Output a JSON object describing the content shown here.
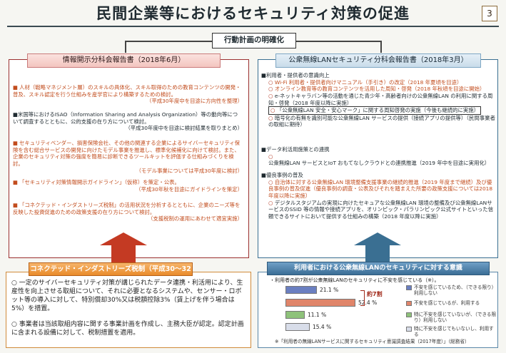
{
  "title": "民間企業等におけるセキュリティ対策の促進",
  "page_number": "3",
  "action_plan_label": "行動計画の明確化",
  "left_panel": {
    "heading": "情報開示分科会報告書（2018年6月）",
    "item1_text": "人材（戦略マネジメント層）のスキルの具体化、スキル取得のための教育コンテンツの開発・普及、スキル認定を行う仕組みを産学官により構築するための検討。",
    "item1_tag": "（平成30年度中を目途に方向性を整理）",
    "item2_text": "米国等におけるISAO（Information Sharing and Analysis Organization）等の動向等について調査するとともに、公的支援の在り方について検討。",
    "item2_tag": "（平成30年度中を目途に検討結果を取りまとめ）",
    "item3_text": "セキュリティベンダー、損害保険会社、その他の関連する企業によるサイバーセキュリティ保険を含む総合サービスの開発に向けたモデル事業を推進し、標準化候補化に向けて検討。また、企業のセキュリティ対策の強度を簡易に診断できるツールキットを評価する仕組みづくりを検討。",
    "item3_tag": "（モデル事業については平成30年度に検討）",
    "item4_text": "「セキュリティ対策情報開示ガイドライン」（仮称）を策定・公表。",
    "item4_tag": "（平成30年秋を目途にガイドラインを策定）",
    "item5_text": "「コネクテッド・インダストリーズ税制」の活用状況を分析するとともに、企業のニーズ等を反映した投資促進のための政策支援の在り方について検討。",
    "item5_tag": "（支援税制の運用にあわせて適宜実施）"
  },
  "right_panel": {
    "heading": "公衆無線LANセキュリティ分科会報告書（2018年3月）",
    "sec1_title": "利用者・提供者の意識向上",
    "sec1_a": "Wi-Fi 利用者・提供者向けマニュアル（手引き）の改定（2018 年夏頃を目途）",
    "sec1_b": "オンライン教育等の教育コンテンツを活用した周知・啓発（2018 年秋頃を目途に開始）",
    "sec1_c": "e-ネットキャラバン等の活動を通じた青少年・高齢者向けの公衆無線LAN の利用に関する周知・啓発（2018 年度以降に実施）",
    "sec1_d": "「公衆無線LAN 安全・安心マーク」に関する周知啓発の実施（今後も継続的に実施）",
    "sec1_e": "暗号化の有無を識別可能な公衆無線LAN サービスの提供（接続アプリの提供等）（民間事業者の取組に期待）",
    "sec2_title": "データ利活用施策との連携",
    "sec2_a": "公衆無線LAN サービスとIoT おもてなしクラウドとの連携推進（2019 年中を目途に実用化）",
    "sec3_title": "優良事例の普及",
    "sec3_a": "自治体に対する公衆無線LAN 環境整備支援事業の継続的推進（2019 年度まで継続）及び優良事例の普及促進（優良事例の調査・公表及びそれを踏まえた所要の政策支援については2018年度以降に実施）",
    "sec3_b": "デジタルスタジアムの実現に向けたセキュアな公衆無線LAN 環境の整備及び公衆無線LANサービスのSSID 等の情報や接続アプリを、オリンピック・パラリンピック公式サイトといった信頼できるサイトにおいて提供する仕組みの構築（2018 年度以降に実施）"
  },
  "tax_panel": {
    "heading": "コネクテッド・インダストリーズ税制（平成30～32年度）",
    "para1": "一定のサイバーセキュリティ対策が講じられたデータ連携・利活用により、生産性を向上させる取組について、それに必要となるシステムや、センサー・ロボット等の導入に対して、特別償却30%又は税額控除3%（賃上げを伴う場合は5%）を措置。",
    "para2": "事業者は当該取組内容に関する事業計画を作成し、主務大臣が認定。認定計画に含まれる設備に対して、税制措置を適用。"
  },
  "survey_panel": {
    "heading": "利用者における公衆無線LANのセキュリティに対する意識",
    "note": "・利用者の約7割が公衆無線LANのセキュリティに不安を感じている（※）。",
    "brace_label": "約7割",
    "source": "※「利用者の無線LANサービスに関するセキュリティ意識調査結果（2017年度）」（総務省）"
  },
  "chart_data": {
    "type": "bar",
    "orientation": "horizontal",
    "categories": [
      "不安を感じているため、（できる限り）利用しない",
      "不安を感じているが、利用する",
      "特に不安を感じていないが、（できる限り）利用しない",
      "特に不安を感じてもいないし、利用する"
    ],
    "values": [
      21.1,
      52.4,
      11.1,
      15.4
    ],
    "value_labels": [
      "21.1 %",
      "52.4 %",
      "11.1 %",
      "15.4 %"
    ],
    "colors": [
      "#6a7fc1",
      "#e0856a",
      "#8ec27a",
      "#d8dde9"
    ],
    "title": "",
    "xlabel": "",
    "ylabel": ""
  }
}
